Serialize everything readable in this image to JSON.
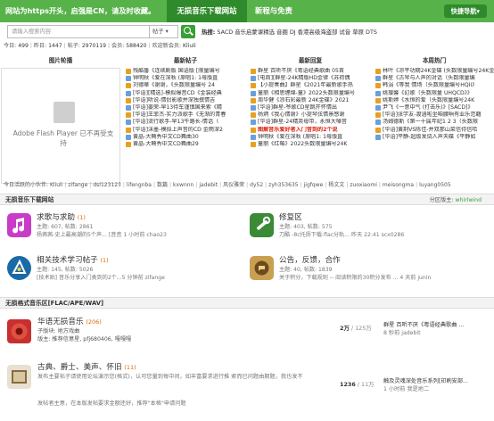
{
  "topbar": {
    "notice": "网站为https开头，启强是CN，请及时收藏。",
    "tab_active": "无损音乐下载网站",
    "tab_other": "新程与免责",
    "bonus_button": "快捷导航▾"
  },
  "search": {
    "placeholder": "请输入搜索内容",
    "scope": "帖子 ▾",
    "hot_label": "热搜:",
    "hot_terms": "SACD  音乐启蒙课精选  音圈  DJ  香港高级海盗部  试音  草原  DTS"
  },
  "stats": {
    "today_label": "今日:",
    "today": "499",
    "yesterday_label": "昨日:",
    "yesterday": "1447",
    "posts_label": "帖子:",
    "posts": "2970119",
    "members_label": "会员:",
    "members": "588420",
    "newest_label": "欢迎新会员:",
    "newest": "Kliuli"
  },
  "columns": {
    "images": "图片轮播",
    "newest": "最新帖子",
    "replies": "最新回复",
    "hot": "本周热门"
  },
  "flash": {
    "message": "Adobe Flash Player 已不再受支持"
  },
  "newest_posts": [
    {
      "text": "残酷番《连续剧版 国语版 [限量编号",
      "style": "dark",
      "color": "#e8a020"
    },
    {
      "text": "钟明秋《爱在深秋 (原唱1: 1母版直",
      "style": "dark",
      "color": "#6a9fd8"
    },
    {
      "text": "刘德華《谢谢，《头数限量编号 24",
      "style": "dark",
      "color": "#e8a020"
    },
    {
      "text": "[华语][精选]-模拟爆音CD《金装经典",
      "style": "dark",
      "color": "#6a9fd8"
    },
    {
      "text": "[华语]听说-情侣影歌并深独撰情吉",
      "style": "dark",
      "color": "#e8a020"
    },
    {
      "text": "[华语]姜荣-早13待车谨慎国来索《精",
      "style": "dark",
      "color": "#6a9fd8"
    },
    {
      "text": "[华语]王菲杰-实力派歌手《无渐的青春",
      "style": "dark",
      "color": "#e8a020"
    },
    {
      "text": "[华语]流行歌手-早13牛路长-情话（",
      "style": "dark",
      "color": "#6a9fd8"
    },
    {
      "text": "[华语]沫墨-模拟上声音的CD 金雨深2",
      "style": "dark",
      "color": "#e8a020"
    },
    {
      "text": "黄晶-大畸秀中文CD舞曲30",
      "style": "dark",
      "color": "#6a9fd8"
    },
    {
      "text": "黄晶-大畸秀中文CD舞曲29",
      "style": "dark",
      "color": "#e8a020"
    }
  ],
  "newest_replies": [
    {
      "text": "群星 百听不厌《粤语经典歌曲 05首",
      "style": "dark",
      "color": "#e8a020"
    },
    {
      "text": "[电商][群星-24K精版HD金律《苏荷偶",
      "style": "dark",
      "color": "#6a9fd8"
    },
    {
      "text": "【小提奏曲】群星《2021年最新歌手热",
      "style": "dark",
      "color": "#e8a020"
    },
    {
      "text": "童丽《相思缠绵-童》2022头数限量编号",
      "style": "dark",
      "color": "#6a9fd8"
    },
    {
      "text": "周华健《凉石彩最新 24K金碟》2021",
      "style": "dark",
      "color": "#e8a020"
    },
    {
      "text": "[华语]群星-爷歌CD星跳开怀情出",
      "style": "dark",
      "color": "#6a9fd8"
    },
    {
      "text": "杨炳《我心情谢》小提琴弦情景感谢",
      "style": "dark",
      "color": "#e8a020"
    },
    {
      "text": "[华语]群星-24精英母带，永恒大嗓音",
      "style": "dark",
      "color": "#6a9fd8"
    },
    {
      "text": "图解音乐爱好者入门音到的2个说",
      "style": "red",
      "color": "#e8a020"
    },
    {
      "text": "钟明秋《爱在深秋 (原唱1: 1母版直",
      "style": "dark",
      "color": "#6a9fd8"
    },
    {
      "text": "童丽《红莓》2022头数限量编号24K",
      "style": "dark",
      "color": "#e8a020"
    }
  ],
  "hot_posts": [
    {
      "text": "林叶《凉平功期24K金碟 (头数限量编号24K金",
      "style": "dark",
      "color": "#e8a020"
    },
    {
      "text": "群星《古琴与人声的对话（头数限量编",
      "style": "dark",
      "color": "#6a9fd8"
    },
    {
      "text": "韩涓《等我 情场（头数限量编号HQII》",
      "style": "dark",
      "color": "#e8a020"
    },
    {
      "text": "姚璎馨《幻歌（头数限量 UHQCD》》",
      "style": "dark",
      "color": "#6a9fd8"
    },
    {
      "text": "姚斯婷《水恒的爱（头数限量编号24K",
      "style": "dark",
      "color": "#e8a020"
    },
    {
      "text": "尹飞《一意中气 (打击乐)》[SACD]》",
      "style": "dark",
      "color": "#6a9fd8"
    },
    {
      "text": "[华语]张学友-渡涵啦坐咱腰晌有业乐范籍",
      "style": "dark",
      "color": "#e8a020"
    },
    {
      "text": "汤姆德斯《第一十属年纪1 2 3（头数限",
      "style": "dark",
      "color": "#6a9fd8"
    },
    {
      "text": "[华语]黄荆VS陈佳-并双那山菜信待信哈",
      "style": "dark",
      "color": "#e8a020"
    },
    {
      "text": "[华语]平静-超级发烧人声天碟《平静如",
      "style": "dark",
      "color": "#6a9fd8"
    }
  ],
  "friends": {
    "label": "今日活跃的小伙伴:",
    "names": [
      "Kliuli",
      "zifange",
      "dsl123123",
      "lifengnba",
      "数篇",
      "kxwnnn",
      "jadebit",
      "风仪雅荣",
      "dy52",
      "zyh353635",
      "jigfqwe",
      "杨文文",
      "zuoxiaomi",
      "meisongma",
      "luyang0505"
    ]
  },
  "section1": {
    "title": "无损音乐下载网站",
    "moderator_label": "分区版主:",
    "moderator": "whirlwind"
  },
  "forums": [
    {
      "title": "求歌与求助",
      "count": "(1)",
      "stats": "主题: 607, 帖数: 2861",
      "last": "杨茜茜-史上最高潮的5个声... [音音 1 小时前 chao23",
      "color": "#c83cc8"
    },
    {
      "title": "修复区",
      "count": "",
      "stats": "主题: 403, 帖数: 575",
      "last": "刀酷 -8c托扬下载-flac分轨... 昨天 22:41 scx0286",
      "color": "#3a8a36"
    },
    {
      "title": "相关技术学习帖子",
      "count": "(1)",
      "stats": "主题: 145, 帖数: 5026",
      "last": "[技术贴] 音乐分享入门类到的2个...5 分钟前 zifange",
      "color": "#1a6aa8"
    },
    {
      "title": "公告，反馈，合作",
      "count": "",
      "stats": "主题: 40, 帖数: 1839",
      "last": "关于积分，下载规则 -- 阅读积限的30积分发布 ... 4 天前 junin",
      "color": "#a07830"
    }
  ],
  "section2": {
    "title": "无损格式音乐区[FLAC/APE/WAV]"
  },
  "row_forums": [
    {
      "title": "华语无损音乐",
      "count": "(206)",
      "sub1": "子版块: 地方戏曲",
      "sub2": "版主: 推荐信意星, pfj680406, 嘎嘎嘎",
      "counts": "2万",
      "counts_total": "/ 125万",
      "last_title": "群星 百听不厌《粤语经典歌曲 ...",
      "last_sub": "8 秒前 jadebit",
      "color": "#c83030"
    },
    {
      "title": "古典、爵士、美声、怀旧",
      "count": "(11)",
      "sub1": "发布主要帖子请使用论坛演示您(格式)，认可您量到每中间，如丰富要求进行推 索而已问题由期题，我也发不",
      "sub2": "发帖者主意，在本版发帖要求金额还好，推荐\"本格\"申请问题",
      "counts": "1236",
      "counts_total": "/ 11万",
      "last_title": "触及灵魂深处音乐系列[印刷安部...",
      "last_sub": "1 小时前 我是地二",
      "color": "#6a4a30"
    }
  ]
}
